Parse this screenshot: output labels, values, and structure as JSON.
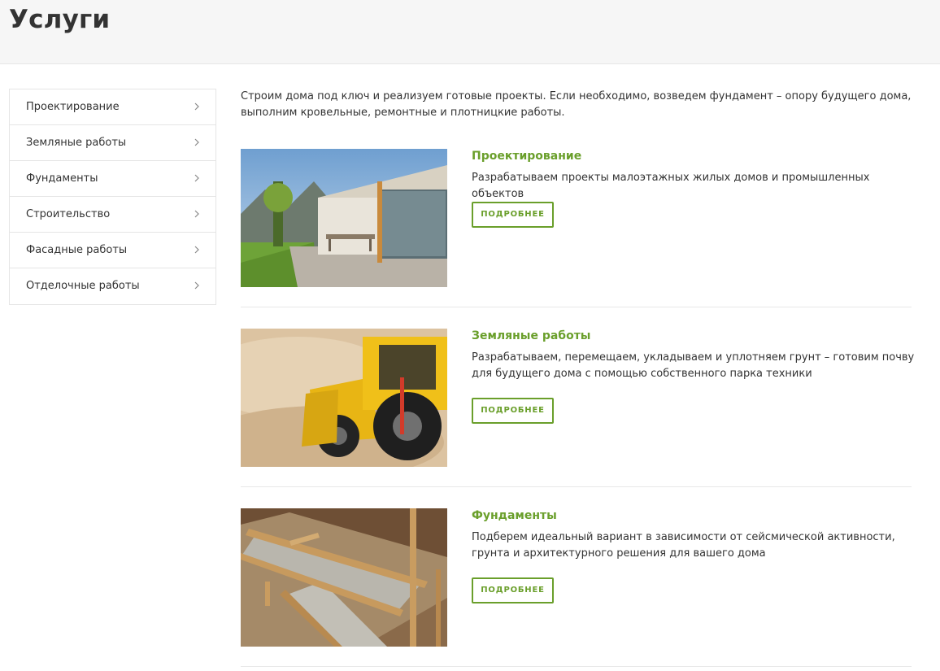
{
  "header": {
    "title": "Услуги"
  },
  "sidebar": {
    "items": [
      {
        "label": "Проектирование"
      },
      {
        "label": "Земляные работы"
      },
      {
        "label": "Фундаменты"
      },
      {
        "label": "Строительство"
      },
      {
        "label": "Фасадные работы"
      },
      {
        "label": "Отделочные работы"
      }
    ],
    "icon": "chevron-right-icon"
  },
  "main": {
    "intro": "Строим дома под ключ и реализуем готовые проекты. Если необходимо, возведем фундамент – опору будущего дома, выполним кровельные, ремонтные и плотницкие работы.",
    "services": [
      {
        "title": "Проектирование",
        "description": "Разрабатываем проекты малоэтажных жилых домов и промышленных объектов",
        "button_label": "ПОДРОБНЕЕ",
        "image": "modern-house-photo"
      },
      {
        "title": "Земляные работы",
        "description": "Разрабатываем, перемещаем, укладываем и уплотняем грунт – готовим почву для будущего дома с помощью собственного парка техники",
        "button_label": "ПОДРОБНЕЕ",
        "image": "excavator-photo"
      },
      {
        "title": "Фундаменты",
        "description": "Подберем идеальный вариант в зависимости от сейсмической активности, грунта и архитектурного решения для вашего дома",
        "button_label": "ПОДРОБНЕЕ",
        "image": "foundation-formwork-photo"
      }
    ]
  },
  "colors": {
    "accent": "#6a9f2b",
    "text": "#333333",
    "header_bg": "#f6f6f6",
    "border": "#e5e5e5"
  }
}
